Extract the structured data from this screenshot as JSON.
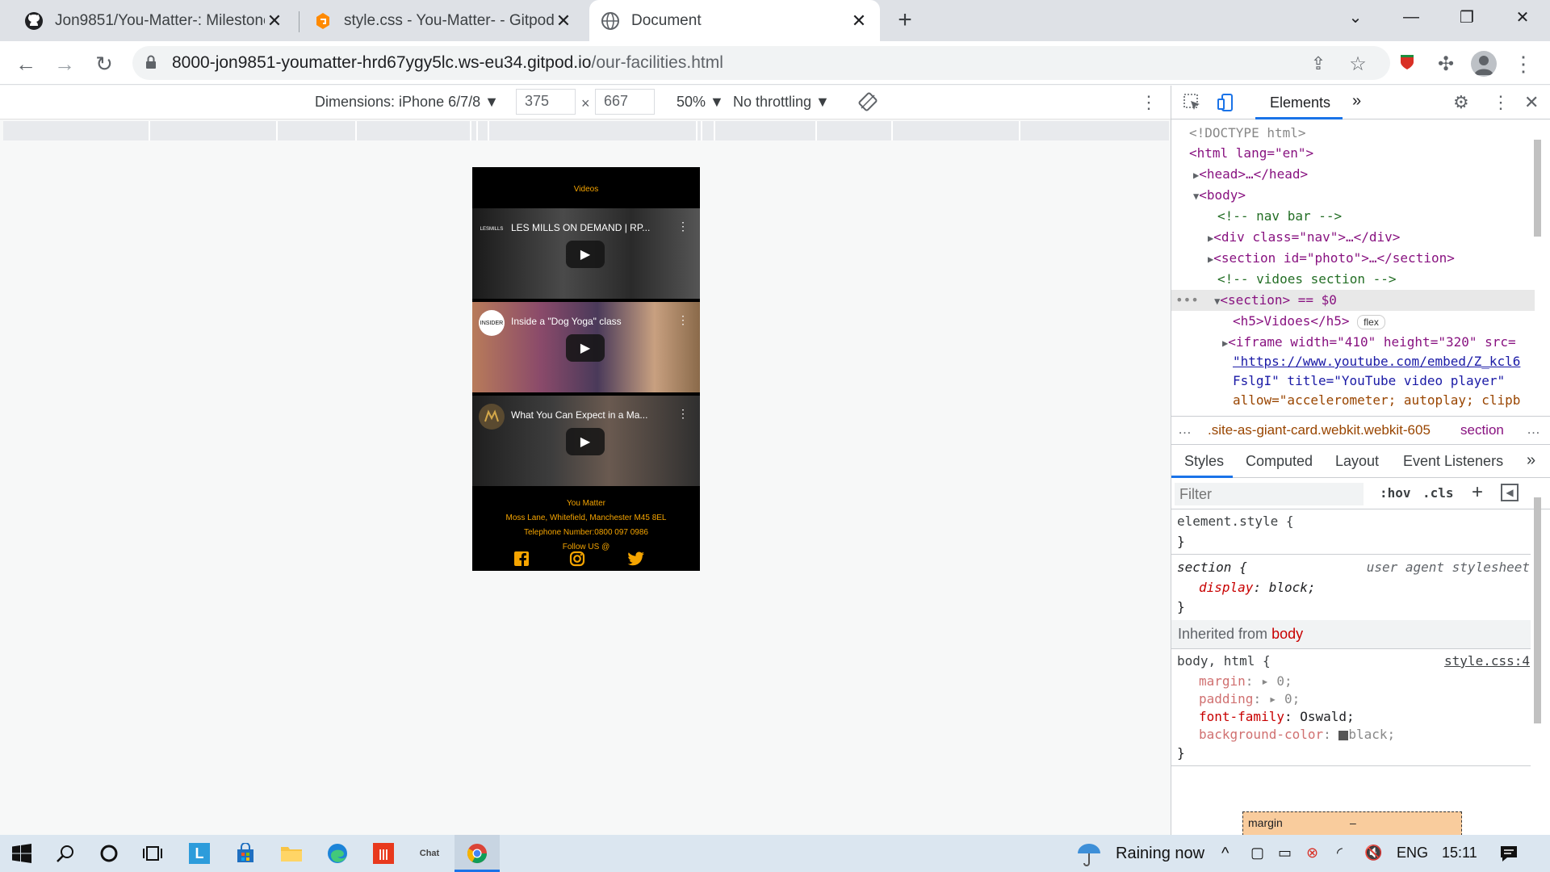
{
  "browser": {
    "tabs": [
      {
        "title": "Jon9851/You-Matter-: Milestone",
        "icon": "github-icon"
      },
      {
        "title": "style.css - You-Matter- - Gitpod C",
        "icon": "gitpod-icon"
      },
      {
        "title": "Document",
        "icon": "globe-icon"
      }
    ],
    "new_tab_label": "+",
    "url_host": "8000-jon9851-youmatter-hrd67ygy5lc.ws-eu34.gitpod.io",
    "url_path": "/our-facilities.html"
  },
  "device_toolbar": {
    "dimensions_label": "Dimensions: iPhone 6/7/8 ▼",
    "width": "375",
    "times": "×",
    "height": "667",
    "zoom": "50% ▼",
    "throttling": "No throttling ▼"
  },
  "page": {
    "section_title": "Videos",
    "videos": [
      {
        "title": "LES MILLS ON DEMAND | RP...",
        "channel": "LESMILLS",
        "bg": "#2b2b2b"
      },
      {
        "title": "Inside a \"Dog Yoga\" class",
        "channel": "INSIDER",
        "bg": "#6b4a3a"
      },
      {
        "title": "What You Can Expect in a Ma...",
        "channel": "",
        "bg": "#3a3a3a"
      }
    ],
    "footer": {
      "name": "You Matter",
      "address": "Moss Lane, Whitefield, Manchester M45 8EL",
      "phone": "Telephone Number:0800 097 0986",
      "follow": "Follow US @"
    }
  },
  "devtools": {
    "elements_tab": "Elements",
    "more_tabs": "»",
    "dom_lines": [
      {
        "html": "<span class='gray'>&lt;!DOCTYPE html&gt;</span>"
      },
      {
        "html": "<span class='tag'>&lt;html</span> <span class='attr'>lang</span>=<span class='val'>\"en\"</span><span class='tag'>&gt;</span>"
      }
    ],
    "dom": {
      "doctype": "<!DOCTYPE html>",
      "html_open": "<html lang=\"en\">",
      "head": "<head>…</head>",
      "body": "<body>",
      "comment_nav": "<!-- nav bar  -->",
      "div_nav": "<div class=\"nav\">…</div>",
      "section_photo": "<section id=\"photo\">…</section>",
      "comment_videos": "<!-- vidoes section -->",
      "section_selected": "<section> == $0",
      "h5": "<h5>Vidoes</h5>",
      "flex_badge": "flex",
      "iframe_1": "<iframe width=\"410\" height=\"320\" src=",
      "iframe_2": "\"https://www.youtube.com/embed/Z_kcl6",
      "iframe_3": "FslgI\" title=\"YouTube video player\"",
      "iframe_4": "allow=\"accelerometer; autoplay; clipb"
    },
    "breadcrumb": ".site-as-giant-card.webkit.webkit-605",
    "breadcrumb_current": "section",
    "style_tabs": [
      "Styles",
      "Computed",
      "Layout",
      "Event Listeners"
    ],
    "filter_placeholder": "Filter",
    "hov": ":hov",
    "cls": ".cls",
    "element_style": "element.style {",
    "close_brace": "}",
    "section_rule": "section {",
    "user_agent": "user agent stylesheet",
    "display_prop": "display",
    "display_val": "block;",
    "inherited_label": "Inherited from",
    "inherited_from": "body",
    "body_rule": "body, html {",
    "stylesheet_link": "style.css:4",
    "margin_prop": "margin",
    "margin_val": "0;",
    "padding_prop": "padding",
    "padding_val": "0;",
    "font_prop": "font-family",
    "font_val": "Oswald;",
    "bg_prop": "background-color",
    "bg_val": "black;",
    "box_label": "margin",
    "box_dash": "–"
  },
  "taskbar": {
    "weather": "Raining now",
    "lang": "ENG",
    "time": "15:11"
  },
  "colors": {
    "accent_orange": "#f5a400",
    "devtools_blue": "#1a73e8"
  }
}
